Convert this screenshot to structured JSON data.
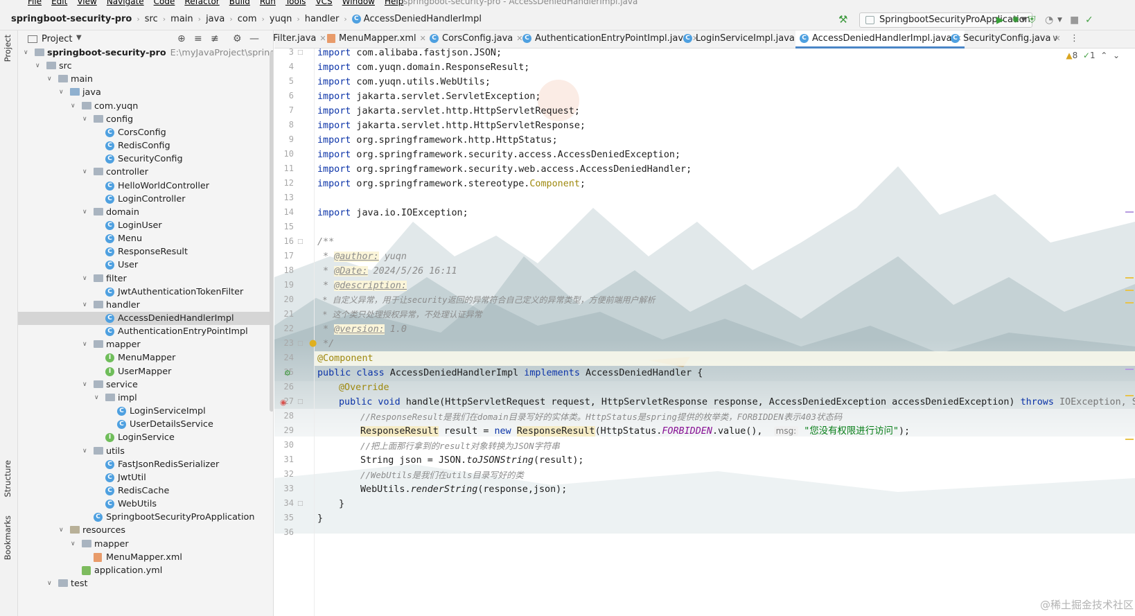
{
  "window": {
    "menus": [
      "File",
      "Edit",
      "View",
      "Navigate",
      "Code",
      "Refactor",
      "Build",
      "Run",
      "Tools",
      "VCS",
      "Window",
      "Help"
    ],
    "title": "springboot-security-pro - AccessDeniedHandlerImpl.java"
  },
  "breadcrumb": [
    "springboot-security-pro",
    "src",
    "main",
    "java",
    "com",
    "yuqn",
    "handler",
    "AccessDeniedHandlerImpl"
  ],
  "run_config": "SpringbootSecurityProApplication",
  "side_tabs": {
    "project": "Project",
    "structure": "Structure",
    "bookmarks": "Bookmarks"
  },
  "project_panel": {
    "title": "Project",
    "tree": [
      {
        "label": "springboot-security-pro",
        "path": "E:\\myJavaProject\\springboot-",
        "type": "module",
        "depth": 0,
        "open": true
      },
      {
        "label": "src",
        "type": "folder",
        "depth": 1,
        "open": true
      },
      {
        "label": "main",
        "type": "folder",
        "depth": 2,
        "open": true
      },
      {
        "label": "java",
        "type": "srcfolder",
        "depth": 3,
        "open": true
      },
      {
        "label": "com.yuqn",
        "type": "package",
        "depth": 4,
        "open": true
      },
      {
        "label": "config",
        "type": "package",
        "depth": 5,
        "open": true
      },
      {
        "label": "CorsConfig",
        "type": "class",
        "depth": 6
      },
      {
        "label": "RedisConfig",
        "type": "class",
        "depth": 6
      },
      {
        "label": "SecurityConfig",
        "type": "class",
        "depth": 6
      },
      {
        "label": "controller",
        "type": "package",
        "depth": 5,
        "open": true
      },
      {
        "label": "HelloWorldController",
        "type": "class",
        "depth": 6
      },
      {
        "label": "LoginController",
        "type": "class",
        "depth": 6
      },
      {
        "label": "domain",
        "type": "package",
        "depth": 5,
        "open": true
      },
      {
        "label": "LoginUser",
        "type": "class",
        "depth": 6
      },
      {
        "label": "Menu",
        "type": "class",
        "depth": 6
      },
      {
        "label": "ResponseResult",
        "type": "class",
        "depth": 6
      },
      {
        "label": "User",
        "type": "class",
        "depth": 6
      },
      {
        "label": "filter",
        "type": "package",
        "depth": 5,
        "open": true
      },
      {
        "label": "JwtAuthenticationTokenFilter",
        "type": "class",
        "depth": 6
      },
      {
        "label": "handler",
        "type": "package",
        "depth": 5,
        "open": true
      },
      {
        "label": "AccessDeniedHandlerImpl",
        "type": "class",
        "depth": 6,
        "selected": true
      },
      {
        "label": "AuthenticationEntryPointImpl",
        "type": "class",
        "depth": 6
      },
      {
        "label": "mapper",
        "type": "package",
        "depth": 5,
        "open": true
      },
      {
        "label": "MenuMapper",
        "type": "interface",
        "depth": 6
      },
      {
        "label": "UserMapper",
        "type": "interface",
        "depth": 6
      },
      {
        "label": "service",
        "type": "package",
        "depth": 5,
        "open": true
      },
      {
        "label": "impl",
        "type": "package",
        "depth": 6,
        "open": true
      },
      {
        "label": "LoginServiceImpl",
        "type": "class",
        "depth": 7
      },
      {
        "label": "UserDetailsService",
        "type": "class",
        "depth": 7
      },
      {
        "label": "LoginService",
        "type": "interface",
        "depth": 6
      },
      {
        "label": "utils",
        "type": "package",
        "depth": 5,
        "open": true
      },
      {
        "label": "FastJsonRedisSerializer",
        "type": "class",
        "depth": 6
      },
      {
        "label": "JwtUtil",
        "type": "class",
        "depth": 6
      },
      {
        "label": "RedisCache",
        "type": "class",
        "depth": 6
      },
      {
        "label": "WebUtils",
        "type": "class",
        "depth": 6
      },
      {
        "label": "SpringbootSecurityProApplication",
        "type": "class",
        "depth": 5
      },
      {
        "label": "resources",
        "type": "resfolder",
        "depth": 3,
        "open": true
      },
      {
        "label": "mapper",
        "type": "folder",
        "depth": 4,
        "open": true
      },
      {
        "label": "MenuMapper.xml",
        "type": "xml",
        "depth": 5
      },
      {
        "label": "application.yml",
        "type": "yml",
        "depth": 4
      },
      {
        "label": "test",
        "type": "folder",
        "depth": 2,
        "open": true
      }
    ]
  },
  "tabs": [
    {
      "label": "Filter.java",
      "icon": "none"
    },
    {
      "label": "MenuMapper.xml",
      "icon": "xml"
    },
    {
      "label": "CorsConfig.java",
      "icon": "class"
    },
    {
      "label": "AuthenticationEntryPointImpl.java",
      "icon": "class"
    },
    {
      "label": "LoginServiceImpl.java",
      "icon": "class"
    },
    {
      "label": "AccessDeniedHandlerImpl.java",
      "icon": "class",
      "active": true
    },
    {
      "label": "SecurityConfig.java",
      "icon": "class"
    }
  ],
  "inspections": {
    "warnings": "8",
    "checks": "1"
  },
  "editor": {
    "line_numbers": [
      "3",
      "4",
      "5",
      "6",
      "7",
      "8",
      "9",
      "10",
      "11",
      "12",
      "13",
      "14",
      "15",
      "16",
      "17",
      "18",
      "19",
      "20",
      "21",
      "22",
      "23",
      "24",
      "25",
      "26",
      "27",
      "28",
      "29",
      "30",
      "31",
      "32",
      "33",
      "34",
      "35",
      "36"
    ],
    "code": {
      "imp": "import",
      "l3": " com.alibaba.fastjson.JSON;",
      "l4": " com.yuqn.domain.ResponseResult;",
      "l5": " com.yuqn.utils.WebUtils;",
      "l6": " jakarta.servlet.ServletException;",
      "l7": " jakarta.servlet.http.HttpServletRequest;",
      "l8": " jakarta.servlet.http.HttpServletResponse;",
      "l9": " org.springframework.http.HttpStatus;",
      "l10": " org.springframework.security.access.AccessDeniedException;",
      "l11": " org.springframework.security.web.access.AccessDeniedHandler;",
      "l12a": " org.springframework.stereotype.",
      "l12b": "Component",
      "l12c": ";",
      "l14": " java.io.IOException;",
      "l16": "/**",
      "star": " * ",
      "tag_author": "@author:",
      "val_author": " yuqn",
      "tag_date": "@Date:",
      "val_date": " 2024/5/26 16:11",
      "tag_desc": "@description:",
      "l20": " * 自定义异常，用于让security返回的异常符合自己定义的异常类型，方便前端用户解析",
      "l21": " * 这个类只处理授权异常，不处理认证异常",
      "tag_ver": "@version:",
      "val_ver": " 1.0",
      "l23": " */",
      "l24": "@Component",
      "l25_kw": "public class",
      "l25_name": " AccessDeniedHandlerImpl ",
      "l25_impl": "implements",
      "l25_rest": " AccessDeniedHandler {",
      "l26": "@Override",
      "l27_kw": "public void",
      "l27_rest": " handle(HttpServletRequest request, HttpServletResponse response, AccessDeniedException accessDeniedException) ",
      "l27_throws": "throws",
      "l27_exc": " IOException, S",
      "l28": "//ResponseResult是我们在domain目录写好的实体类。HttpStatus是spring提供的枚举类，FORBIDDEN表示403状态码",
      "l29_type": "ResponseResult",
      "l29_a": " result = ",
      "l29_new": "new",
      "l29_cls": "ResponseResult",
      "l29_b": "(HttpStatus.",
      "l29_field": "FORBIDDEN",
      "l29_c": ".value(),  ",
      "l29_hint": "msg:",
      "l29_str": "\"您没有权限进行访问\"",
      "l29_d": ");",
      "l30": "//把上面那行拿到的result对象转换为JSON字符串",
      "l31_a": "String json = JSON.",
      "l31_m": "toJSONString",
      "l31_b": "(result);",
      "l32": "//WebUtils是我们在utils目录写好的类",
      "l33_a": "WebUtils.",
      "l33_m": "renderString",
      "l33_b": "(response,json);",
      "l34": "}",
      "l35": "}"
    }
  },
  "watermark": "@稀土掘金技术社区",
  "colors": {
    "keyword": "#0b33a8",
    "annotation": "#9e880d",
    "comment": "#8c8c8c",
    "string": "#067d17",
    "accent": "#4a86c7"
  }
}
